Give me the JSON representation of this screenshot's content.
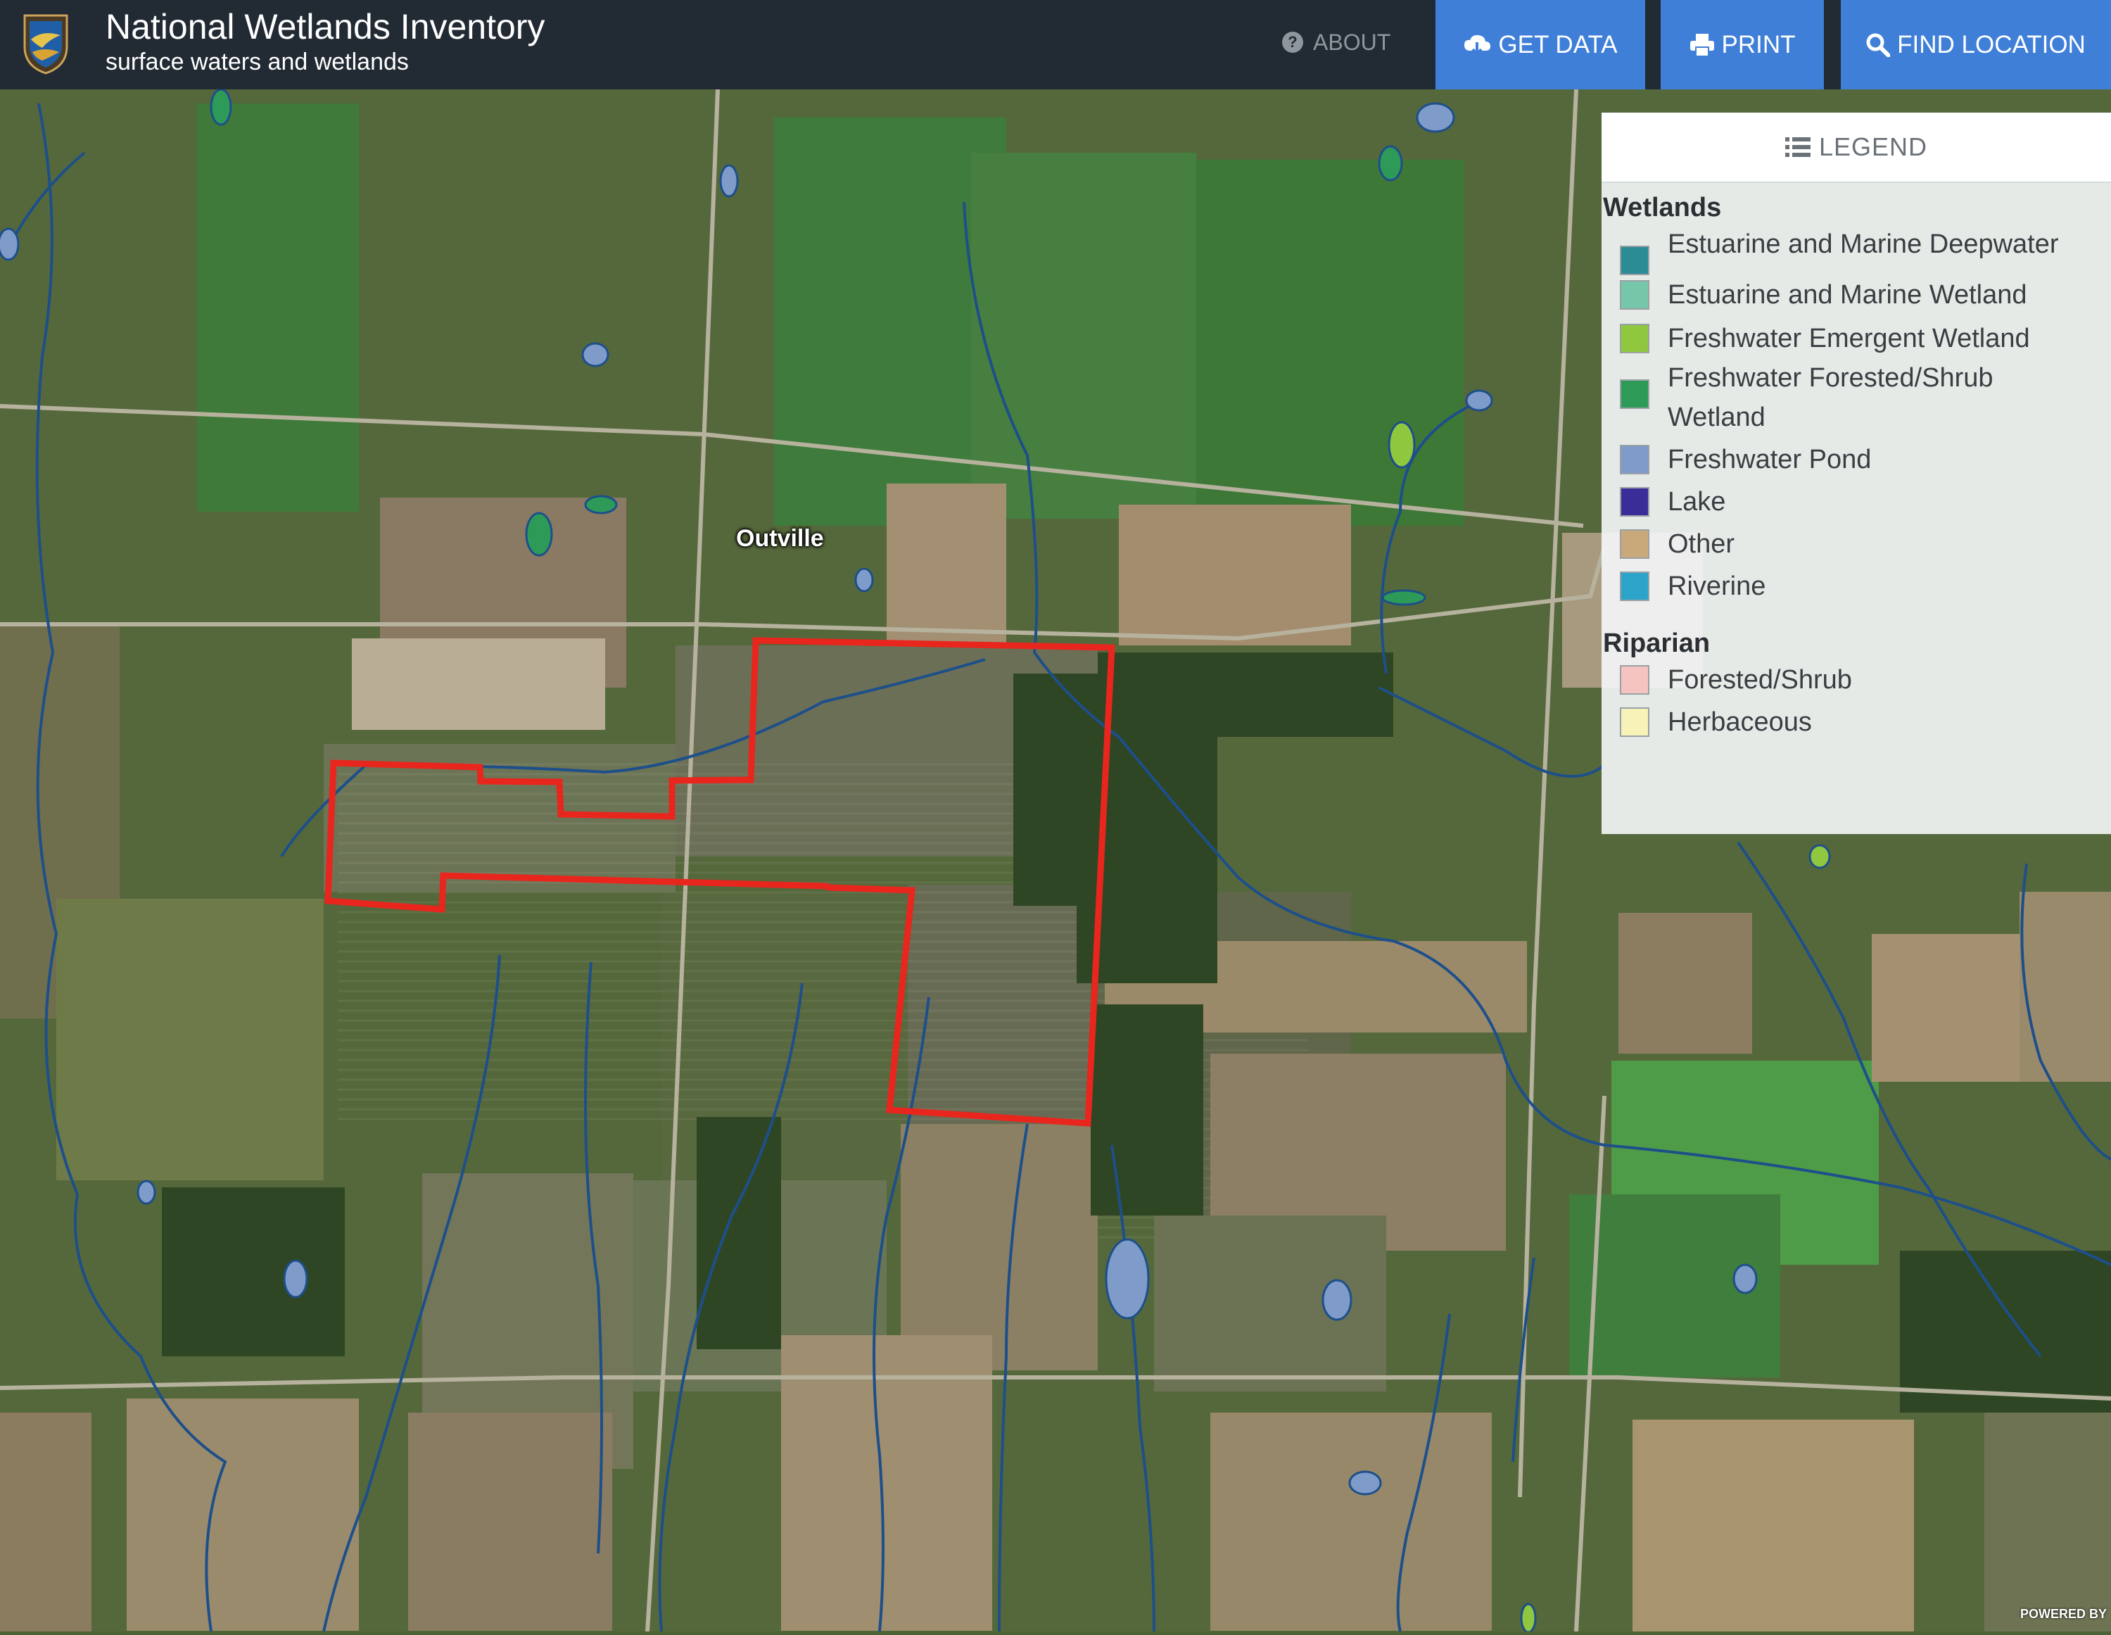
{
  "header": {
    "title": "National Wetlands Inventory",
    "subtitle": "surface waters and wetlands",
    "about_label": "ABOUT",
    "buttons": [
      {
        "label": "GET DATA",
        "icon": "cloud-download-icon"
      },
      {
        "label": "PRINT",
        "icon": "printer-icon"
      },
      {
        "label": "FIND LOCATION",
        "icon": "search-icon"
      }
    ]
  },
  "map": {
    "place_label": "Outville",
    "attribution": "POWERED BY"
  },
  "legend": {
    "title": "LEGEND",
    "sections": [
      {
        "name": "Wetlands",
        "items": [
          {
            "label": "Estuarine and Marine Deepwater",
            "color": "#2c8c95"
          },
          {
            "label": "Estuarine and Marine Wetland",
            "color": "#76c7a9"
          },
          {
            "label": "Freshwater Emergent Wetland",
            "color": "#8fc73e"
          },
          {
            "label": "Freshwater Forested/Shrub Wetland",
            "color": "#2e9a57"
          },
          {
            "label": "Freshwater Pond",
            "color": "#7f9bc9"
          },
          {
            "label": "Lake",
            "color": "#3b2d99"
          },
          {
            "label": "Other",
            "color": "#c9a97a"
          },
          {
            "label": "Riverine",
            "color": "#2ca4c9"
          }
        ]
      },
      {
        "name": "Riparian",
        "items": [
          {
            "label": "Forested/Shrub",
            "color": "#f5c3c0"
          },
          {
            "label": "Herbaceous",
            "color": "#f6f2b8"
          }
        ]
      }
    ]
  },
  "colors": {
    "header_bg": "#222a33",
    "button_bg": "#3f7fd8",
    "parcel_outline": "#e8261e",
    "stream": "#1d4f8a"
  }
}
